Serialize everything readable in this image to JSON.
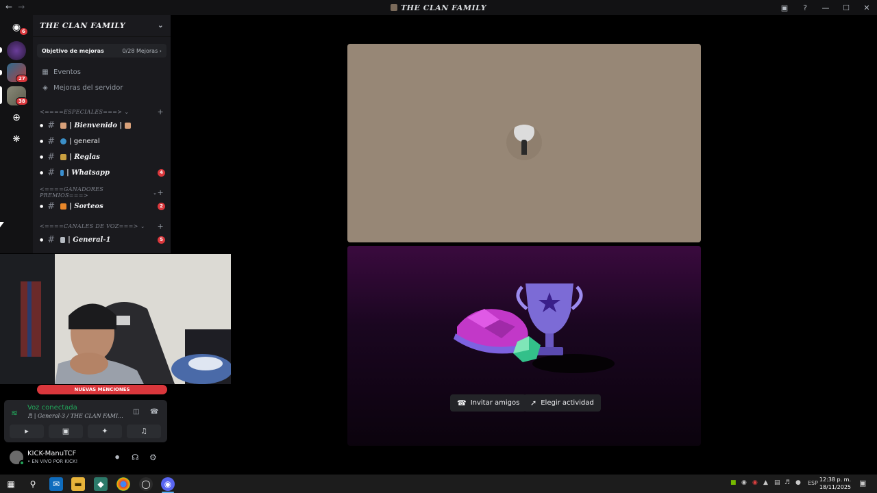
{
  "window": {
    "title": "THE CLAN FAMILY"
  },
  "guilds": {
    "discord_badge": "6",
    "server2_badge": "27",
    "server3_badge": "38"
  },
  "server": {
    "name": "THE CLAN FAMILY",
    "boost_label": "Objetivo de mejoras",
    "boost_progress": "0/28 Mejoras",
    "events": "Eventos",
    "server_boosts": "Mejoras del servidor"
  },
  "categories": {
    "especiales": "<====ESPECIALES===>",
    "ganadores": "<====GANADORES PREMIOS===>",
    "voz": "<====CANALES DE VOZ===>"
  },
  "channels": {
    "bienvenido": "| Bienvenido |",
    "general": "| general",
    "reglas": "| Reglas",
    "whatsapp": "| Whatsapp",
    "whatsapp_count": "4",
    "sorteos": "| Sorteos",
    "sorteos_count": "2",
    "general1": "| General-1",
    "general1_count": "5"
  },
  "new_mentions": "NUEVAS MENCIONES",
  "voice": {
    "status": "Voz conectada",
    "channel": "| General-3 / THE CLAN FAMI..."
  },
  "user": {
    "name": "KICK-ManuTCF",
    "status": "• EN VIVO POR KICK!"
  },
  "stage": {
    "invite_label": "Invitar amigos",
    "activity_label": "Elegir actividad"
  },
  "taskbar": {
    "lang": "ESP",
    "time": "12:38 p. m.",
    "date": "18/11/2025"
  }
}
